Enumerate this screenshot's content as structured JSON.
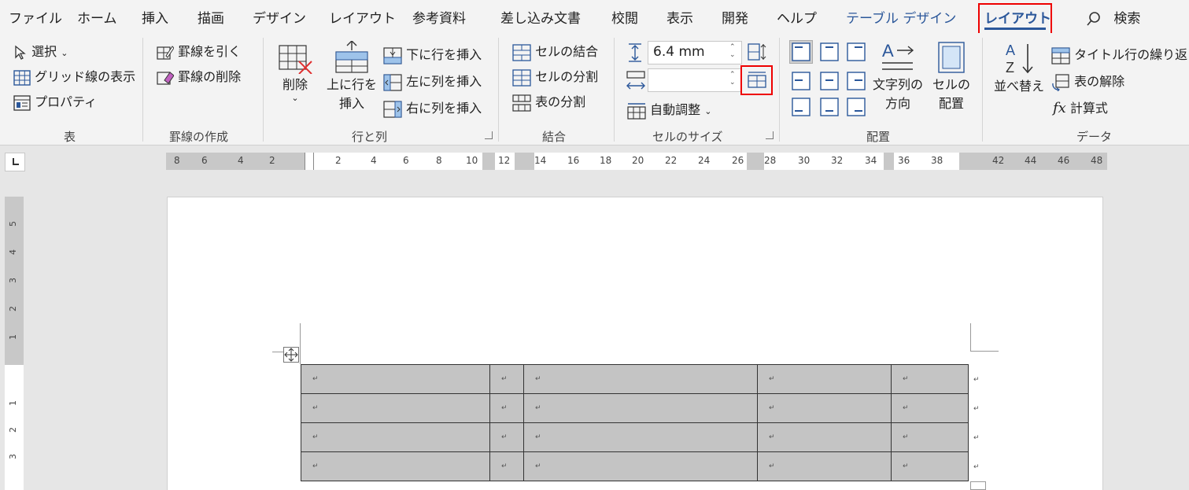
{
  "menu": {
    "tabs": [
      "ファイル",
      "ホーム",
      "挿入",
      "描画",
      "デザイン",
      "レイアウト",
      "参考資料",
      "差し込み文書",
      "校閲",
      "表示",
      "開発",
      "ヘルプ",
      "テーブル デザイン",
      "レイアウト"
    ],
    "search": "検索"
  },
  "ribbon": {
    "table_group": {
      "select": "選択",
      "gridlines": "グリッド線の表示",
      "properties": "プロパティ",
      "label": "表"
    },
    "borders_group": {
      "draw": "罫線を引く",
      "erase": "罫線の削除",
      "label": "罫線の作成"
    },
    "rows_group": {
      "delete": "削除",
      "insert_above_1": "上に行を",
      "insert_above_2": "挿入",
      "insert_below": "下に行を挿入",
      "insert_left": "左に列を挿入",
      "insert_right": "右に列を挿入",
      "label": "行と列"
    },
    "merge_group": {
      "merge": "セルの結合",
      "split_cells": "セルの分割",
      "split_table": "表の分割",
      "label": "結合"
    },
    "size_group": {
      "height_value": "6.4 mm",
      "width_value": "",
      "autofit": "自動調整",
      "label": "セルのサイズ"
    },
    "align_group": {
      "direction_1": "文字列の",
      "direction_2": "方向",
      "margins_1": "セルの",
      "margins_2": "配置",
      "label": "配置"
    },
    "data_group": {
      "sort": "並べ替え",
      "repeat_header": "タイトル行の繰り返し",
      "convert": "表の解除",
      "formula": "計算式",
      "fx": "fx",
      "label": "データ"
    }
  },
  "ruler": {
    "h_numbers": [
      "8",
      "6",
      "4",
      "2",
      "2",
      "4",
      "6",
      "8",
      "10",
      "12",
      "14",
      "16",
      "18",
      "20",
      "22",
      "24",
      "26",
      "28",
      "30",
      "32",
      "34",
      "36",
      "38",
      "42",
      "44",
      "46",
      "48"
    ],
    "v_numbers": [
      "5",
      "4",
      "3",
      "2",
      "1",
      "1",
      "2",
      "3"
    ]
  },
  "table": {
    "rows": 4,
    "cols": 5,
    "cell_mark": "↵"
  },
  "colors": {
    "accent": "#2b579a",
    "highlight": "#e00000",
    "cell_shade": "#c4c4c4"
  }
}
